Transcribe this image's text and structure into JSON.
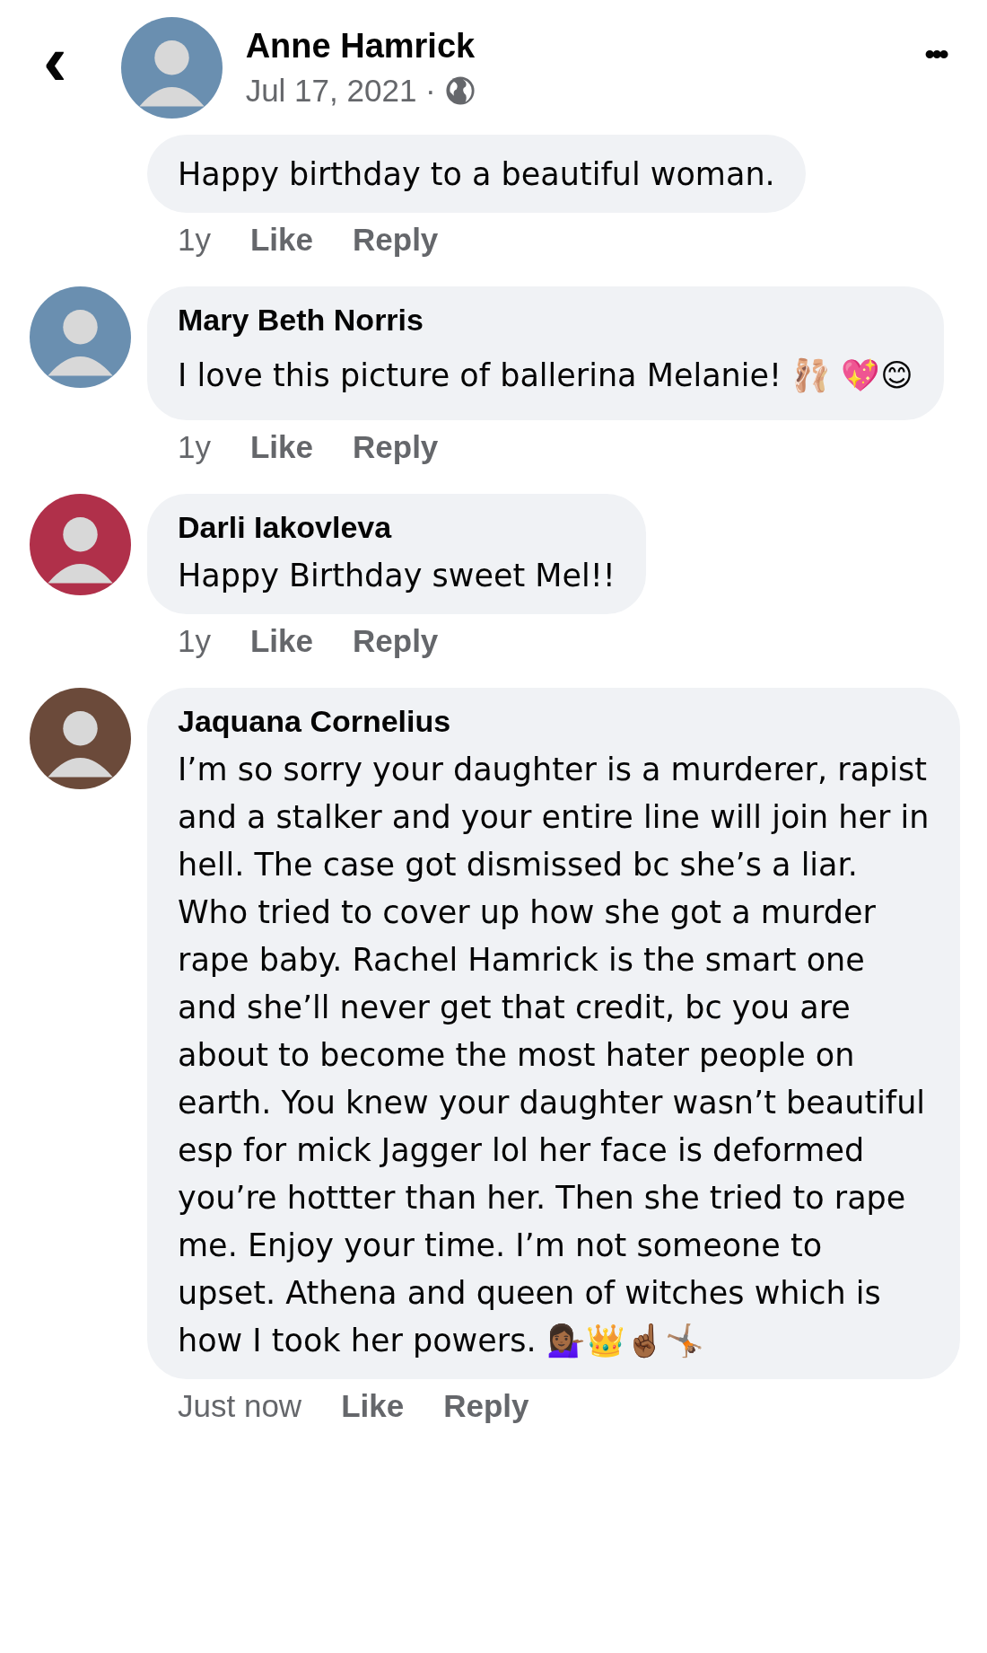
{
  "header": {
    "back": "‹",
    "name": "Anne Hamrick",
    "date": "Jul 17, 2021 ·",
    "more": "•••"
  },
  "comments": [
    {
      "text": "Happy birthday to a beautiful woman.",
      "time": "1y",
      "actions": [
        "Like",
        "Reply"
      ]
    },
    {
      "author": "Mary Beth Norris",
      "text": "I love this picture of ballerina Melanie! 🩰 💖😊",
      "time": "1y",
      "actions": [
        "Like",
        "Reply"
      ]
    },
    {
      "author": "Darli Iakovleva",
      "text": "Happy Birthday sweet Mel!!",
      "time": "1y",
      "actions": [
        "Like",
        "Reply"
      ]
    },
    {
      "author": "Jaquana Cornelius",
      "text": "I’m so sorry your daughter is a murderer, rapist and a stalker and your entire line will join her in hell. The case got dismissed bc she’s a liar. Who tried to cover up how she got a murder rape baby. Rachel Hamrick is the smart one and she’ll never get that credit, bc you are about to become the most hater people on earth. You knew your daughter wasn’t beautiful esp for mick Jagger lol her face is deformed you’re hottter than her. Then she tried to rape me. Enjoy your time. I’m not someone to upset. Athena and queen of witches which is how I took her powers. 💁🏾‍♀️👑☝🏾🤸🏽",
      "time": "Just now",
      "actions": [
        "Like",
        "Reply"
      ]
    }
  ]
}
